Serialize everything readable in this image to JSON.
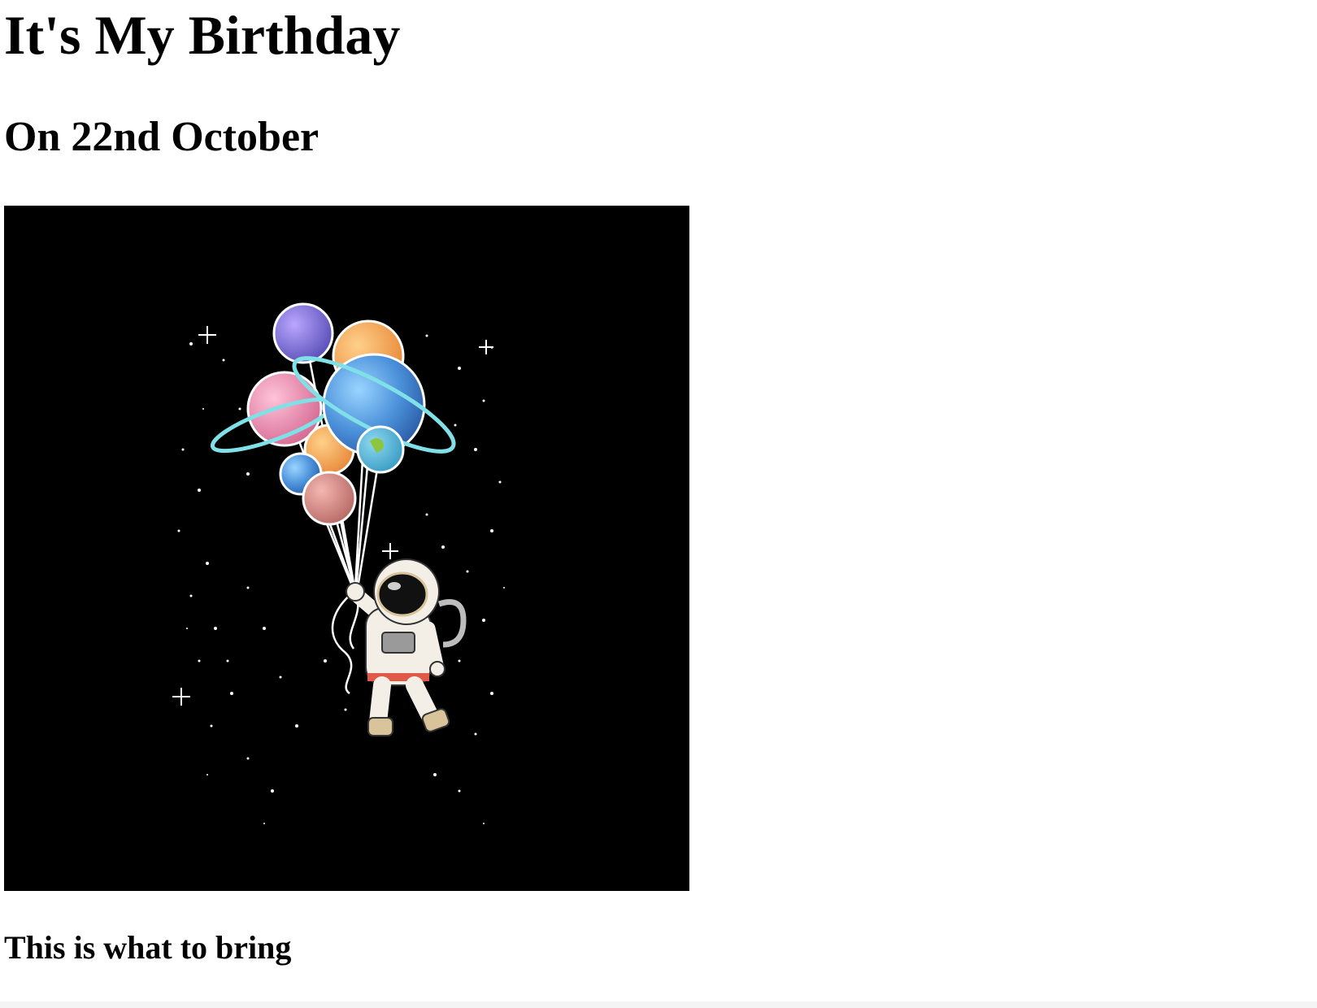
{
  "page": {
    "title": "It's My Birthday",
    "subtitle": "On 22nd October",
    "image": {
      "subject": "astronaut-holding-planet-balloons",
      "background_color": "#000000"
    },
    "bring_heading": "This is what to bring"
  }
}
